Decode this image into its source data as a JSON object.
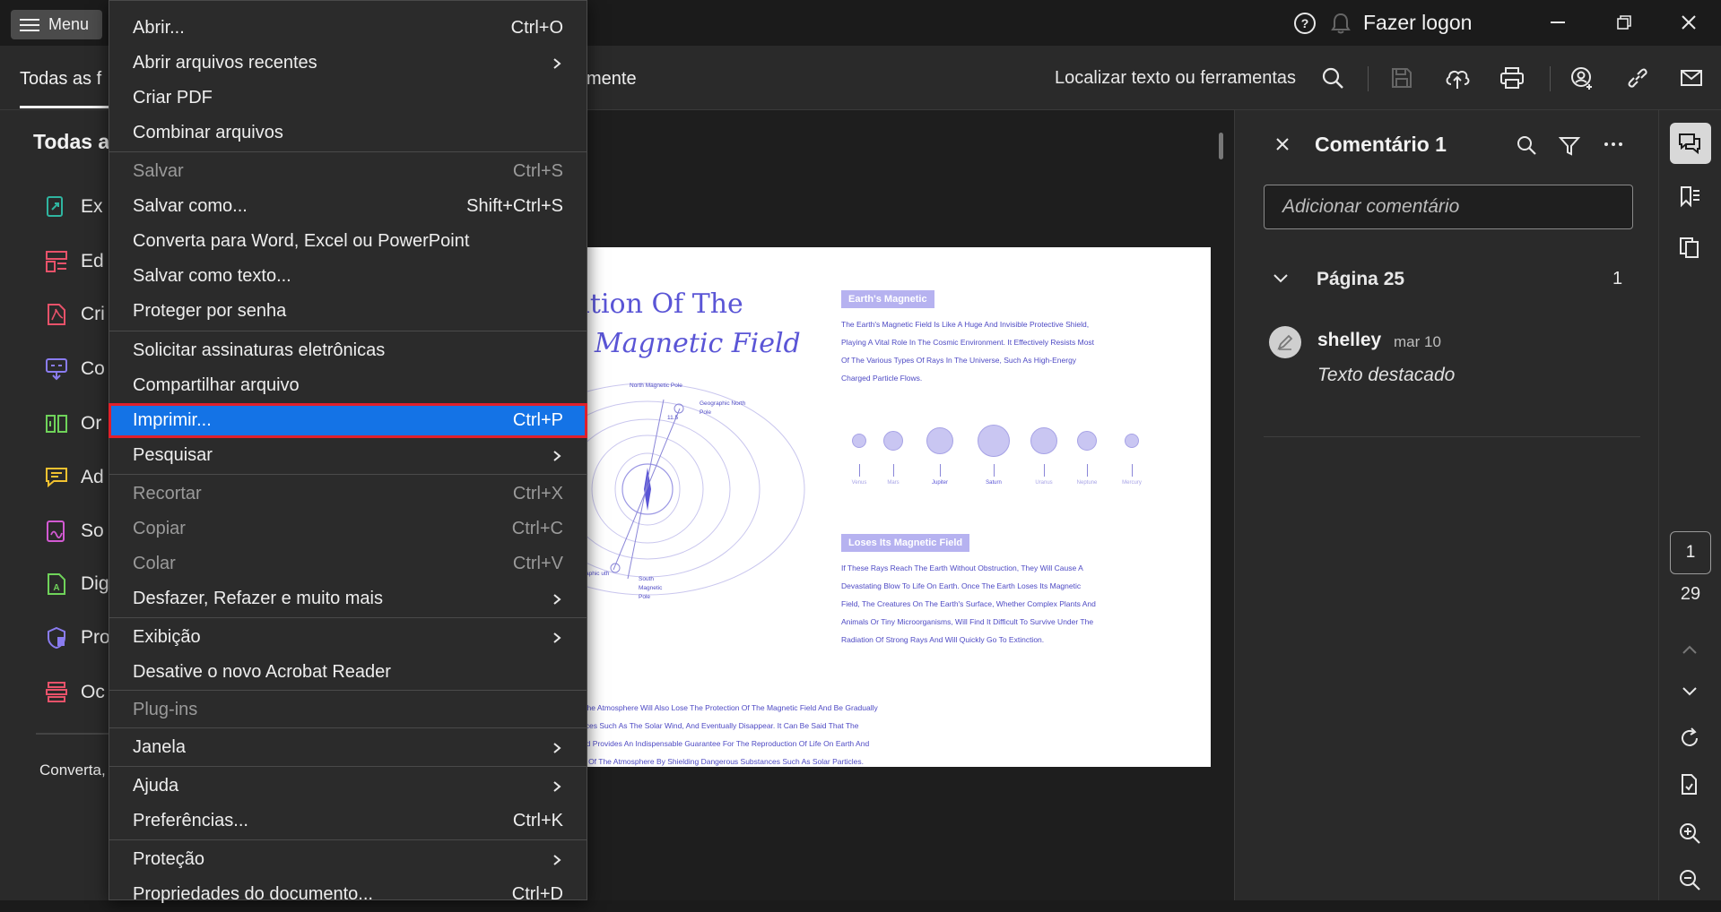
{
  "titlebar": {
    "menu_label": "Menu",
    "login_label": "Fazer logon",
    "icons": [
      "help-icon",
      "bell-icon",
      "minimize-icon",
      "restore-icon",
      "close-icon"
    ]
  },
  "toolbar": {
    "tab_all_fragment": "Todas as f",
    "tab_edit_fragment": "mente",
    "find_label": "Localizar texto ou ferramentas"
  },
  "leftpanel": {
    "title_fragment": "Todas a",
    "items": [
      {
        "label": "Ex",
        "icon": "export-pdf-icon",
        "color": "#2fb5a0"
      },
      {
        "label": "Ed",
        "icon": "edit-pdf-icon",
        "color": "#e8526a"
      },
      {
        "label": "Cri",
        "icon": "create-pdf-icon",
        "color": "#e8526a"
      },
      {
        "label": "Co",
        "icon": "combine-files-icon",
        "color": "#8a7cf0"
      },
      {
        "label": "Or",
        "icon": "organize-pages-icon",
        "color": "#6fd35a"
      },
      {
        "label": "Ad",
        "icon": "add-comment-icon",
        "color": "#f2c230"
      },
      {
        "label": "So",
        "icon": "request-signatures-icon",
        "color": "#d35ad3"
      },
      {
        "label": "Dig",
        "icon": "scan-ocr-icon",
        "color": "#6fd35a"
      },
      {
        "label": "Pro",
        "icon": "protect-icon",
        "color": "#8a7cf0"
      },
      {
        "label": "Oc",
        "icon": "redact-icon",
        "color": "#e8526a"
      }
    ],
    "convert_fragment": "Converta,"
  },
  "menu": {
    "items": [
      {
        "label": "Abrir...",
        "shortcut": "Ctrl+O",
        "submenu": false,
        "disabled": false
      },
      {
        "label": "Abrir arquivos recentes",
        "shortcut": "",
        "submenu": true,
        "disabled": false
      },
      {
        "label": "Criar PDF",
        "shortcut": "",
        "submenu": false,
        "disabled": false
      },
      {
        "label": "Combinar arquivos",
        "shortcut": "",
        "submenu": false,
        "disabled": false
      },
      {
        "label": "Salvar",
        "shortcut": "Ctrl+S",
        "submenu": false,
        "disabled": true
      },
      {
        "label": "Salvar como...",
        "shortcut": "Shift+Ctrl+S",
        "submenu": false,
        "disabled": false
      },
      {
        "label": "Converta para Word, Excel ou PowerPoint",
        "shortcut": "",
        "submenu": false,
        "disabled": false
      },
      {
        "label": "Salvar como texto...",
        "shortcut": "",
        "submenu": false,
        "disabled": false
      },
      {
        "label": "Proteger por senha",
        "shortcut": "",
        "submenu": false,
        "disabled": false
      },
      {
        "label": "Solicitar assinaturas eletrônicas",
        "shortcut": "",
        "submenu": false,
        "disabled": false
      },
      {
        "label": "Compartilhar arquivo",
        "shortcut": "",
        "submenu": false,
        "disabled": false
      },
      {
        "label": "Imprimir...",
        "shortcut": "Ctrl+P",
        "submenu": false,
        "disabled": false,
        "selected": true
      },
      {
        "label": "Pesquisar",
        "shortcut": "",
        "submenu": true,
        "disabled": false
      },
      {
        "label": "Recortar",
        "shortcut": "Ctrl+X",
        "submenu": false,
        "disabled": true
      },
      {
        "label": "Copiar",
        "shortcut": "Ctrl+C",
        "submenu": false,
        "disabled": true
      },
      {
        "label": "Colar",
        "shortcut": "Ctrl+V",
        "submenu": false,
        "disabled": true
      },
      {
        "label": "Desfazer, Refazer e muito mais",
        "shortcut": "",
        "submenu": true,
        "disabled": false
      },
      {
        "label": "Exibição",
        "shortcut": "",
        "submenu": true,
        "disabled": false
      },
      {
        "label": "Desative o novo Acrobat Reader",
        "shortcut": "",
        "submenu": false,
        "disabled": false
      },
      {
        "label": "Plug-ins",
        "shortcut": "",
        "submenu": false,
        "disabled": true
      },
      {
        "label": "Janela",
        "shortcut": "",
        "submenu": true,
        "disabled": false
      },
      {
        "label": "Ajuda",
        "shortcut": "",
        "submenu": true,
        "disabled": false
      },
      {
        "label": "Preferências...",
        "shortcut": "Ctrl+K",
        "submenu": false,
        "disabled": false
      },
      {
        "label": "Proteção",
        "shortcut": "",
        "submenu": true,
        "disabled": false
      },
      {
        "label": "Propriedades do documento...",
        "shortcut": "Ctrl+D",
        "submenu": false,
        "disabled": false
      }
    ]
  },
  "document": {
    "title_line1": "ation Of The",
    "title_line2": "s Magnetic Field",
    "badge1": "Earth's Magnetic",
    "para1": [
      "The Earth's Magnetic Field Is Like A Huge And Invisible Protective Shield,",
      "Playing A Vital Role In The Cosmic Environment. It Effectively Resists Most",
      "Of The Various Types Of Rays In The Universe, Such As High-Energy",
      "Charged Particle Flows."
    ],
    "planets": [
      "Venus",
      "Mars",
      "Jupiter",
      "Saturn",
      "Uranus",
      "Neptune",
      "Mercury"
    ],
    "badge2": "Loses Its Magnetic Field",
    "para2": [
      "If These Rays Reach The Earth Without Obstruction, They Will Cause A",
      "Devastating Blow To Life On Earth. Once The Earth Loses Its Magnetic",
      "Field, The Creatures On The Earth's Surface, Whether Complex Plants And",
      "Animals Or Tiny Microorganisms, Will Find It Difficult To Survive Under The",
      "Radiation Of Strong Rays And Will Quickly Go To Extinction."
    ],
    "para3": [
      "e, The Atmosphere Will Also Lose The Protection Of The Magnetic Field And Be Gradually",
      "Forces Such As The Solar Wind, And Eventually Disappear. It Can Be Said That The",
      "Field Provides An Indispensable Guarantee For The Reproduction Of Life On Earth And",
      "nce Of The Atmosphere By Shielding Dangerous Substances Such As Solar Particles."
    ],
    "diagram_labels": {
      "north_mag": "North Magnetic Pole",
      "geo_north": "Geographic North Pole",
      "geo_south": "eographic uth Pole",
      "south_mag": "South Magnetic Pole",
      "angle": "11.5"
    }
  },
  "comments": {
    "title": "Comentário 1",
    "input_placeholder": "Adicionar comentário",
    "page_label": "Página 25",
    "page_count": "1",
    "user": "shelley",
    "date": "mar 10",
    "text": "Texto destacado"
  },
  "rail": {
    "current_page": "1",
    "total_pages": "29"
  },
  "colors": {
    "accent": "#1473e6",
    "selection_outline": "#e0202a",
    "doc_blue": "#5a55d6"
  }
}
